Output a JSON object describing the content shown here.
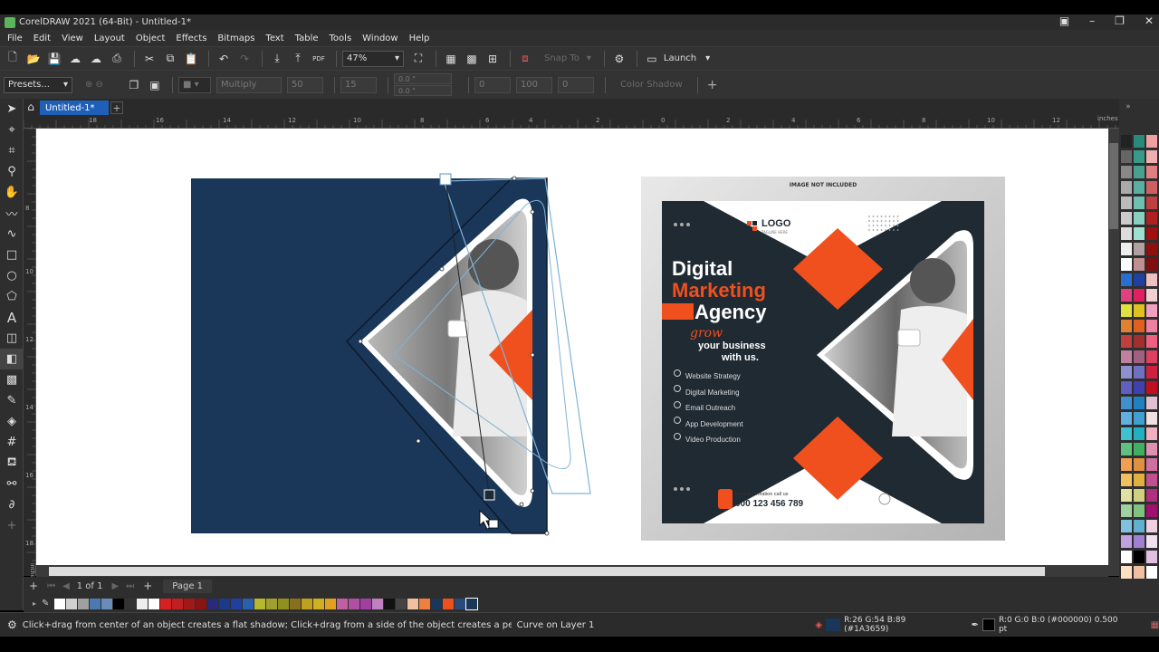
{
  "window": {
    "title": "CorelDRAW 2021 (64-Bit) - Untitled-1*"
  },
  "menu": [
    "File",
    "Edit",
    "View",
    "Layout",
    "Object",
    "Effects",
    "Bitmaps",
    "Text",
    "Table",
    "Tools",
    "Window",
    "Help"
  ],
  "toolbar": {
    "zoom": "47%",
    "snap_to": "Snap To",
    "launch": "Launch",
    "pdf_label": "PDF"
  },
  "propbar": {
    "presets": "Presets...",
    "blend_mode": "Multiply",
    "opacity": "50",
    "feather": "15",
    "offset_x": "0.0 \"",
    "offset_y": "0.0 \"",
    "angle": "0",
    "stretch": "100",
    "fade": "0",
    "color_shadow": "Color Shadow"
  },
  "document": {
    "tab": "Untitled-1*",
    "units": "inches"
  },
  "rulers": {
    "h_ticks": [
      "18",
      "16",
      "14",
      "12",
      "10",
      "8",
      "6",
      "4",
      "2",
      "0",
      "2",
      "4",
      "6",
      "8",
      "10",
      "12"
    ],
    "v_ticks": [
      "8",
      "10",
      "12",
      "14",
      "16",
      "18"
    ]
  },
  "pages": {
    "counter": "1  of  1",
    "page_tab": "Page 1"
  },
  "design": {
    "image_note": "IMAGE NOT INCLUDED",
    "logo": "LOGO",
    "logo_tagline": "TAGLINE HERE",
    "headline1": "Digital",
    "headline2": "Marketing",
    "headline3": "Agency",
    "script": "grow",
    "sub1": "your business",
    "sub2": "with us.",
    "services": [
      "Website Strategy",
      "Digital Marketing",
      "Email Outreach",
      "App Development",
      "Video Production"
    ],
    "contact_label": "More information call us",
    "phone": "000 123 456 789",
    "colors": {
      "navy": "#1A3659",
      "dark": "#1f2a33",
      "orange": "#f0501e"
    }
  },
  "statusbar": {
    "hint": "Click+drag from center of an object creates a flat shadow; Click+drag from a side of the object creates a perspective shadow",
    "object": "Curve on Layer 1",
    "fill": "R:26 G:54 B:89 (#1A3659)",
    "outline": "R:0 G:0 B:0 (#000000)  0.500 pt"
  }
}
